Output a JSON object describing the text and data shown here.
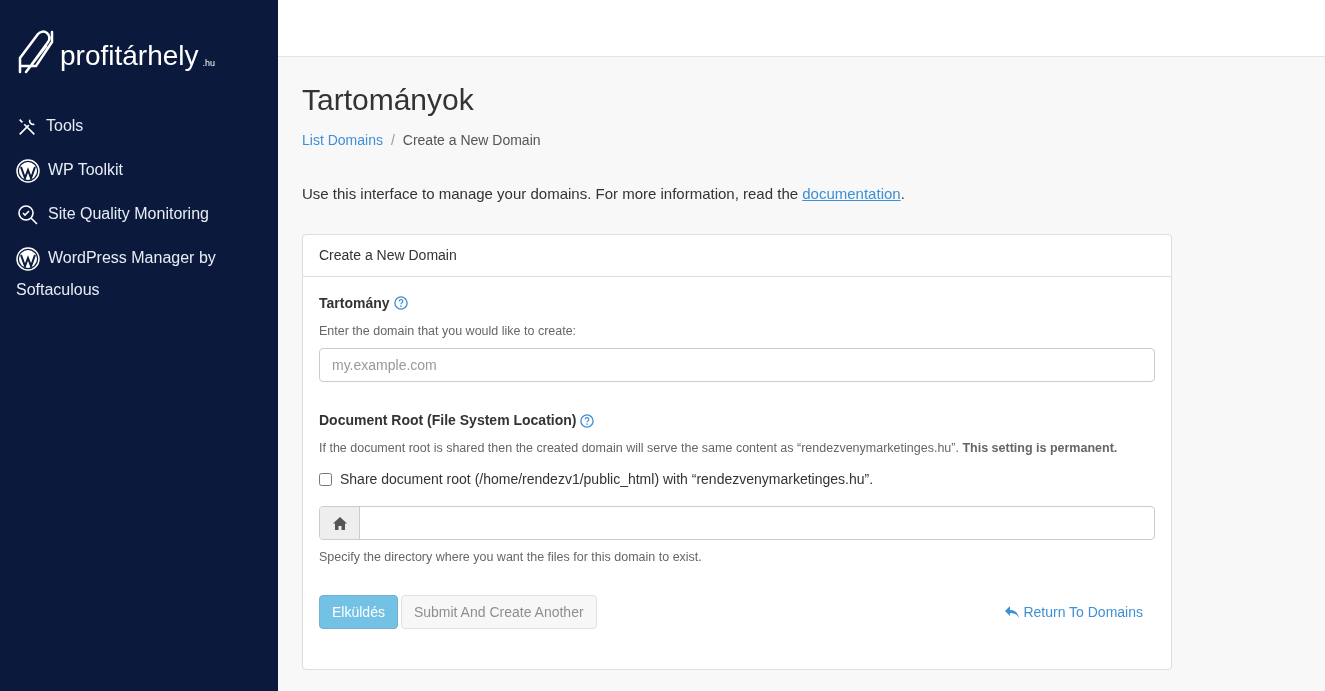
{
  "logo": {
    "name": "profitárhely",
    "suffix": ".hu"
  },
  "sidebar": {
    "items": [
      {
        "label": "Tools",
        "kind": "tools"
      },
      {
        "label": "WP Toolkit",
        "kind": "wordpress"
      },
      {
        "label": "Site Quality Monitoring",
        "kind": "monitoring"
      },
      {
        "label": "WordPress Manager by Softaculous",
        "kind": "wordpress"
      }
    ]
  },
  "page": {
    "title": "Tartományok",
    "breadcrumb_separator": "/",
    "breadcrumb": [
      {
        "label": "List Domains",
        "link": true
      },
      {
        "label": "Create a New Domain",
        "link": false
      }
    ],
    "intro": {
      "text": "Use this interface to manage your domains. For more information, read the",
      "link": "documentation",
      "end": "."
    }
  },
  "panel": {
    "heading": "Create a New Domain",
    "domain": {
      "label": "Tartomány",
      "help": "Enter the domain that you would like to create:",
      "placeholder": "my.example.com"
    },
    "docroot": {
      "label": "Document Root (File System Location)",
      "help": "If the document root is shared then the created domain will serve the same content as “rendezvenymarketinges.hu”. **This setting is permanent.**",
      "share": {
        "label": "Share document root (/home/rendezv1/public_html) with “rendezvenymarketinges.hu”.",
        "checked": false
      },
      "hint": "Specify the directory where you want the files for this domain to exist."
    },
    "buttons": [
      {
        "label": "Elküldés",
        "kind": "primary",
        "disabled": true
      },
      {
        "label": "Submit And Create Another",
        "kind": "secondary",
        "disabled": true
      }
    ],
    "return_link": "Return To Domains"
  }
}
